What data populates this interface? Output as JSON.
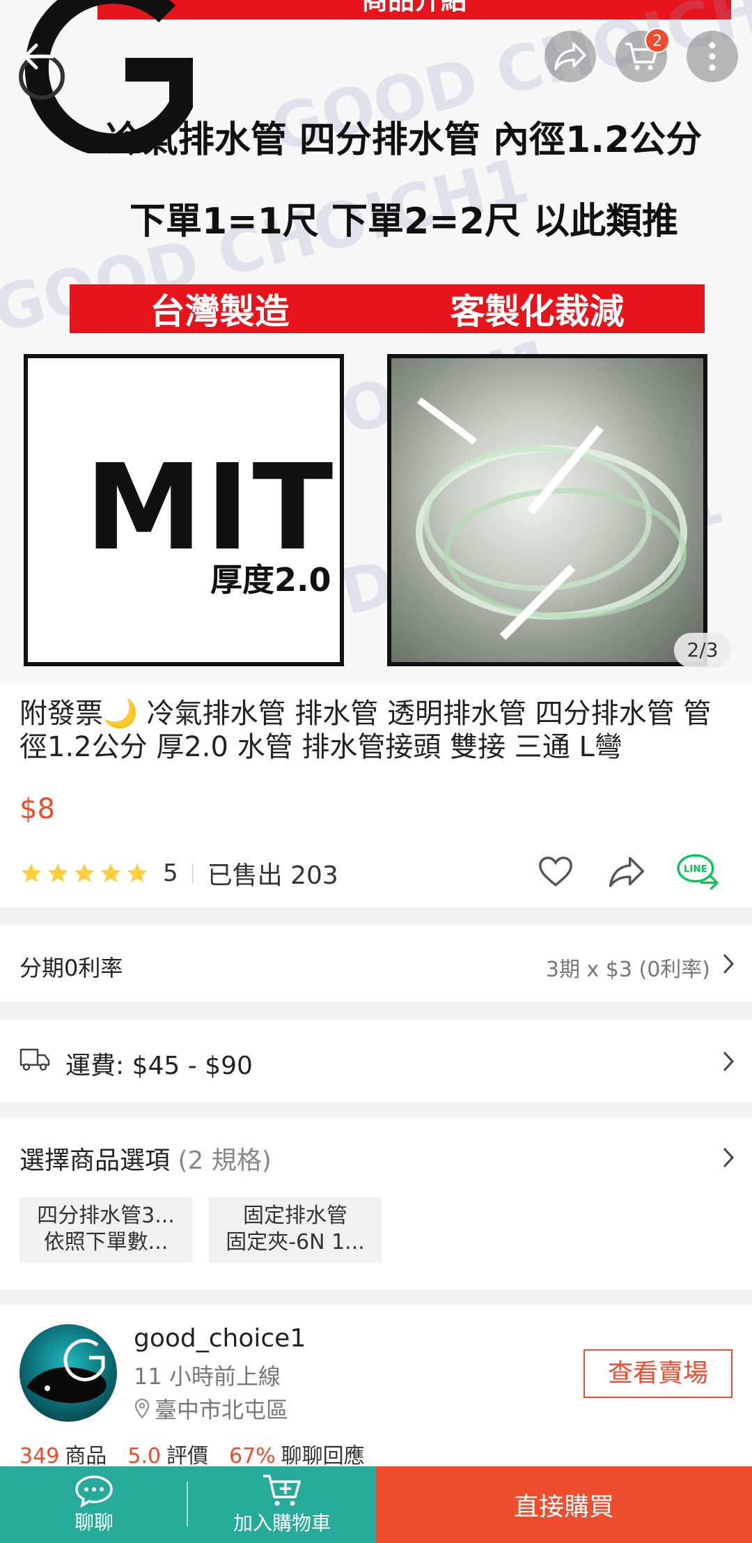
{
  "banner": {
    "top_label": "商品介紹",
    "line1": "冷氣排水管 四分排水管 內徑1.2公分",
    "line2": "下單1=1尺 下單2=2尺 以此類推",
    "band_left": "台灣製造",
    "band_right": "客製化裁減",
    "mit": "MIT",
    "thickness": "厚度2.0",
    "watermark": "GOOD CHOICH1",
    "page_counter": "2/3"
  },
  "header": {
    "cart_count": "2"
  },
  "product": {
    "title": "附發票🌙 冷氣排水管 排水管 透明排水管 四分排水管 管徑1.2公分 厚2.0 水管 排水管接頭 雙接 三通 L彎",
    "price": "$8",
    "rating": "5",
    "sold": "已售出 203"
  },
  "installment": {
    "label": "分期0利率",
    "value": "3期 x $3 (0利率)"
  },
  "shipping": {
    "label": "運費: $45 - $90"
  },
  "options": {
    "label": "選擇商品選項",
    "count": "(2 規格)",
    "variants": [
      {
        "line1": "四分排水管3...",
        "line2": "依照下單數..."
      },
      {
        "line1": "固定排水管",
        "line2": "固定夾-6N 1..."
      }
    ]
  },
  "shop": {
    "name": "good_choice1",
    "online": "11 小時前上線",
    "location": "臺中市北屯區",
    "view_button": "查看賣場",
    "products_num": "349",
    "products_label": "商品",
    "rating_num": "5.0",
    "rating_label": "評價",
    "chat_num": "67%",
    "chat_label": "聊聊回應"
  },
  "bottom_bar": {
    "chat_label": "聊聊",
    "add_cart_label": "加入購物車",
    "buy_now_label": "直接購買"
  },
  "colors": {
    "accent": "#ee4d2d",
    "green": "#26aa99",
    "star": "#ffce3d",
    "line_green": "#06c755"
  }
}
